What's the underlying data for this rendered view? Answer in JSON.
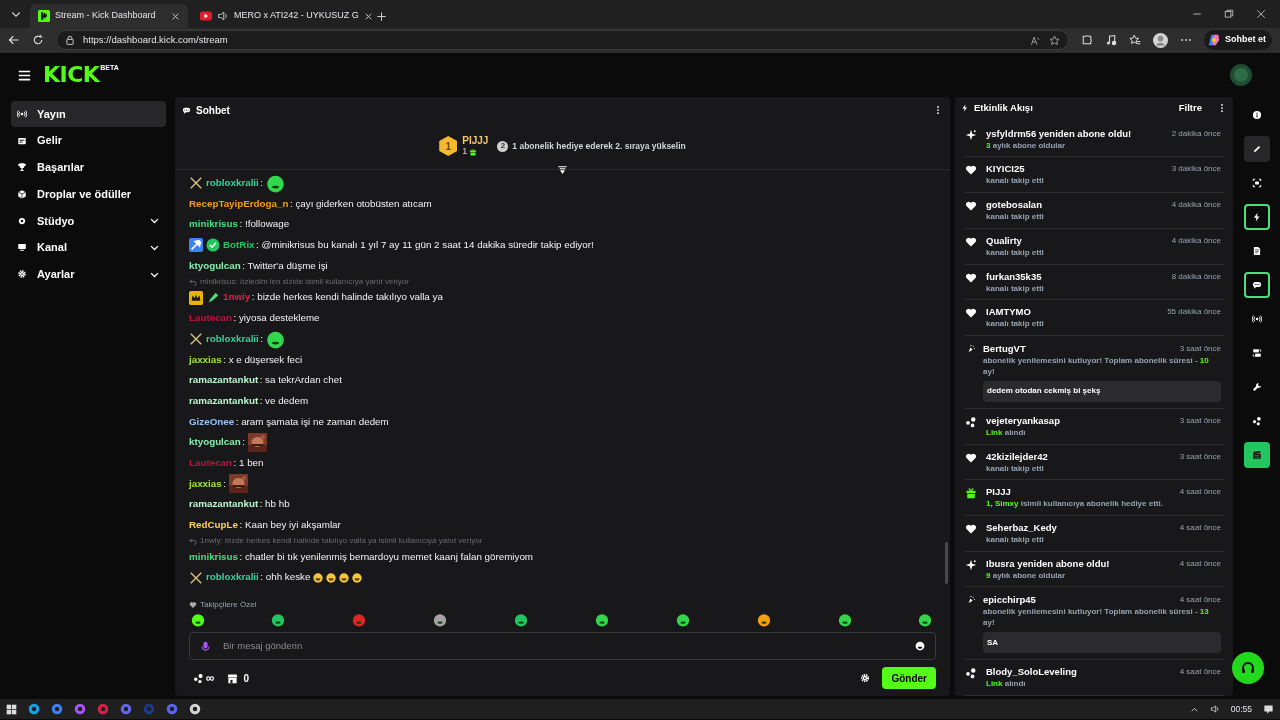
{
  "browser": {
    "tabs": [
      {
        "title": "Stream - Kick Dashboard",
        "selected": true,
        "kind": "kick"
      },
      {
        "title": "MERO x ATI242 - UYKUSUZ G",
        "selected": false,
        "kind": "video"
      }
    ],
    "url": "https://dashboard.kick.com/stream",
    "copilot": "Sohbet et"
  },
  "header": {
    "logo": "KICK",
    "logo_tag": "BETA"
  },
  "sidebar": {
    "items": [
      {
        "label": "Yayın",
        "kind": "link",
        "selected": true
      },
      {
        "label": "Gelir",
        "kind": "link",
        "selected": false
      },
      {
        "label": "Başarılar",
        "kind": "link",
        "selected": false
      },
      {
        "label": "Droplar ve ödüller",
        "kind": "link",
        "selected": false
      },
      {
        "label": "Stüdyo",
        "kind": "group",
        "selected": false
      },
      {
        "label": "Kanal",
        "kind": "group",
        "selected": false
      },
      {
        "label": "Ayarlar",
        "kind": "group",
        "selected": false
      }
    ]
  },
  "chat": {
    "title": "Sohbet",
    "leader": {
      "rank": "1",
      "user": "PIJJJ",
      "count": "1",
      "next_rank": "2",
      "hint": "1 abonelik hediye ederek 2. sıraya yükselin"
    },
    "messages": [
      {
        "kind": "emote",
        "user": "robloxkralii",
        "color": "#34d399",
        "text": ":"
      },
      {
        "kind": "text",
        "user": "RecepTayipErdoga_n",
        "color": "#f59e0b",
        "text": ": çayı giderken otobüsten atıcam"
      },
      {
        "kind": "text",
        "user": "minikrisus",
        "color": "#4ade80",
        "text": ": !followage"
      },
      {
        "kind": "text",
        "user": "BotRix",
        "color": "#22c55e",
        "text": ": @minikrisus bu kanalı 1 yıl 7 ay 11 gün 2 saat 14 dakika süredir takip ediyor!"
      },
      {
        "kind": "text",
        "user": "ktyogulcan",
        "color": "#86efac",
        "text": ": Twitter'a düşme işi"
      },
      {
        "kind": "text",
        "user": "1nwiy",
        "color": "#e11d48",
        "reply": "minikrisus: özledim len sizide isimli kullanıcıya yanıt veriyor",
        "text": ": bizde herkes kendi halinde takılıyo valla ya"
      },
      {
        "kind": "text",
        "user": "Lautecan",
        "color": "#be123c",
        "text": ": yiyosa destekleme"
      },
      {
        "kind": "emote",
        "user": "robloxkralii",
        "color": "#34d399",
        "text": ":"
      },
      {
        "kind": "text",
        "user": "jaxxias",
        "color": "#a3e635",
        "text": ": x e düşersek feci"
      },
      {
        "kind": "text",
        "user": "ramazantankut",
        "color": "#bbf7d0",
        "text": ": sa tekrArdan chet"
      },
      {
        "kind": "text",
        "user": "ramazantankut",
        "color": "#bbf7d0",
        "text": ": ve dedem"
      },
      {
        "kind": "text",
        "user": "GizeOnee",
        "color": "#93c5fd",
        "text": ": aram şamata işi ne zaman dedem"
      },
      {
        "kind": "picture",
        "user": "ktyogulcan",
        "color": "#86efac",
        "text": ":"
      },
      {
        "kind": "text",
        "user": "Lautecan",
        "color": "#be123c",
        "text": ": 1 ben"
      },
      {
        "kind": "picture",
        "user": "jaxxias",
        "color": "#a3e635",
        "text": ":"
      },
      {
        "kind": "text",
        "user": "ramazantankut",
        "color": "#bbf7d0",
        "text": ": hb hb"
      },
      {
        "kind": "text",
        "user": "RedCupLe",
        "color": "#fcd34d",
        "text": ": Kaan bey iyi akşamlar"
      },
      {
        "kind": "text",
        "user": "minikrisus",
        "color": "#4ade80",
        "reply": "1nwly: bizde herkes kendi halinde takılıyo valla ya isimli kullanıcıya yanıt veriyor",
        "text": ": chatler bi tık yenilenmiş bernardoyu memet kaanj falan göremiyom"
      },
      {
        "kind": "emoji",
        "user": "robloxkralii",
        "color": "#34d399",
        "text": ": ohh keske"
      }
    ],
    "emote_bar": {
      "title": "Takipçilere Özel"
    },
    "input": {
      "placeholder": "Bir mesaj gönderin"
    },
    "footer": {
      "points": "∞",
      "drops": "0",
      "send": "Gönder"
    }
  },
  "events": {
    "title": "Etkinlik Akışı",
    "filter": "Filtre",
    "items": [
      {
        "kind": "resub",
        "title": "ysfyldrm56 yeniden abone oldu!",
        "time": "2 dakika önce",
        "detail": "**3** aylık abone oldular"
      },
      {
        "kind": "follow",
        "title": "KIYICI25",
        "time": "3 dakika önce",
        "detail": "kanalı takip etti"
      },
      {
        "kind": "follow",
        "title": "gotebosalan",
        "time": "4 dakika önce",
        "detail": "kanalı takip etti"
      },
      {
        "kind": "follow",
        "title": "Qualirty",
        "time": "4 dakika önce",
        "detail": "kanalı takip etti"
      },
      {
        "kind": "follow",
        "title": "furkan35k35",
        "time": "8 dakika önce",
        "detail": "kanalı takip etti"
      },
      {
        "kind": "follow",
        "title": "IAMTYMO",
        "time": "55 dakika önce",
        "detail": "kanalı takip etti"
      },
      {
        "kind": "renewal",
        "title": "BertugVT",
        "time": "3 saat önce",
        "detail": "abonelik yenilemesini kutluyor! Toplam abonelik süresi - **10** ay!",
        "message": "dedem otodan cekmiş bi şekş"
      },
      {
        "kind": "link",
        "title": "vejeteryankasap",
        "time": "3 saat önce",
        "detail": "**Link** alındı"
      },
      {
        "kind": "follow",
        "title": "42kizilejder42",
        "time": "3 saat önce",
        "detail": "kanalı takip etti"
      },
      {
        "kind": "gift",
        "title": "PIJJJ",
        "time": "4 saat önce",
        "detail": "**1, Simxy** isimli kullanıcıya abonelik hediye etti."
      },
      {
        "kind": "follow",
        "title": "Seherbaz_Kedy",
        "time": "4 saat önce",
        "detail": "kanalı takip etti"
      },
      {
        "kind": "resub",
        "title": "Ibusra yeniden abone oldu!",
        "time": "4 saat önce",
        "detail": "**9** aylık abone oldular"
      },
      {
        "kind": "renewal",
        "title": "epicchirp45",
        "time": "4 saat önce",
        "detail": "abonelik yenilemesini kutluyor! Toplam abonelik süresi - **13** ay!",
        "message": "SA"
      },
      {
        "kind": "link",
        "title": "Blody_SoloLeveling",
        "time": "4 saat önce",
        "detail": "**Link** alındı"
      }
    ]
  },
  "rail": {
    "items": [
      {
        "selected": false,
        "on": false,
        "hovered": false
      },
      {
        "selected": false,
        "on": false,
        "hovered": true
      },
      {
        "selected": false,
        "on": false,
        "hovered": false
      },
      {
        "selected": true,
        "on": false,
        "hovered": false
      },
      {
        "selected": false,
        "on": false,
        "hovered": false
      },
      {
        "selected": true,
        "on": false,
        "hovered": false
      },
      {
        "selected": false,
        "on": false,
        "hovered": false
      },
      {
        "selected": false,
        "on": false,
        "hovered": false
      },
      {
        "selected": false,
        "on": false,
        "hovered": false
      },
      {
        "selected": false,
        "on": false,
        "hovered": false
      },
      {
        "selected": false,
        "on": true,
        "hovered": false
      }
    ]
  },
  "taskbar": {
    "time": "00:55"
  }
}
